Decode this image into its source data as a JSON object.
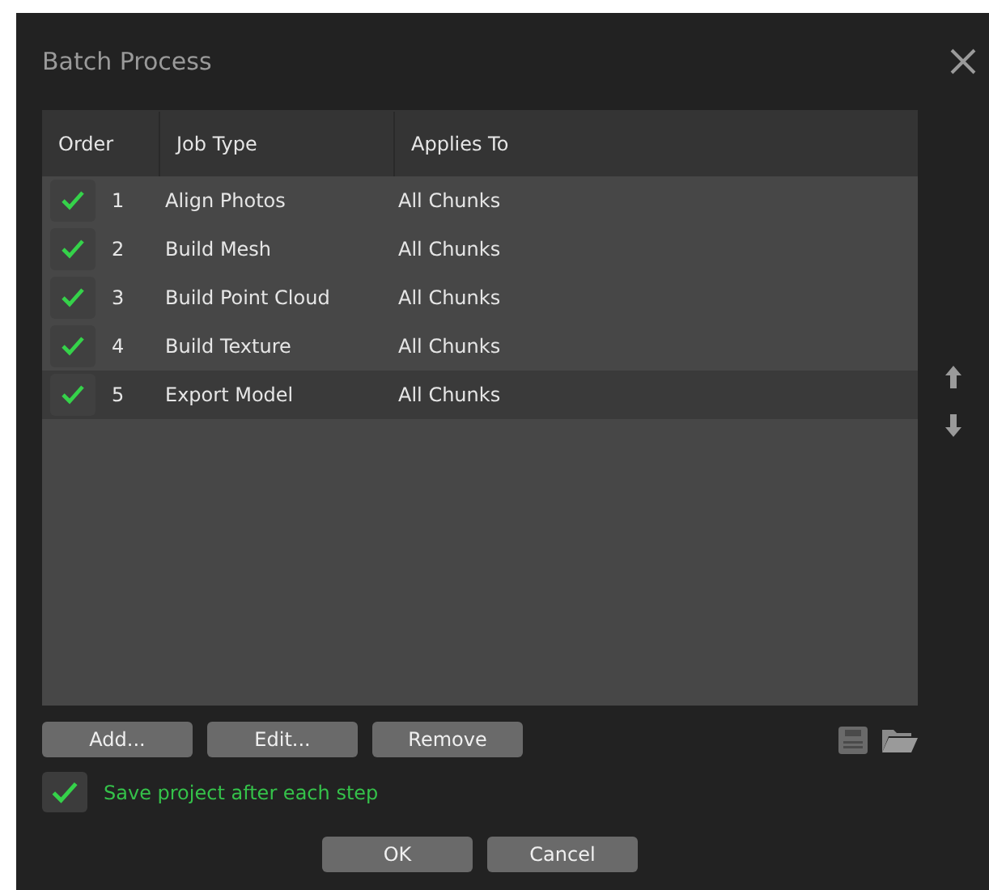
{
  "window": {
    "title": "Batch Process"
  },
  "table": {
    "columns": [
      "Order",
      "Job Type",
      "Applies To"
    ],
    "rows": [
      {
        "checked": true,
        "order": "1",
        "job_type": "Align Photos",
        "applies_to": "All Chunks",
        "selected": false
      },
      {
        "checked": true,
        "order": "2",
        "job_type": "Build Mesh",
        "applies_to": "All Chunks",
        "selected": false
      },
      {
        "checked": true,
        "order": "3",
        "job_type": "Build Point Cloud",
        "applies_to": "All Chunks",
        "selected": false
      },
      {
        "checked": true,
        "order": "4",
        "job_type": "Build Texture",
        "applies_to": "All Chunks",
        "selected": false
      },
      {
        "checked": true,
        "order": "5",
        "job_type": "Export Model",
        "applies_to": "All Chunks",
        "selected": true
      }
    ]
  },
  "list_buttons": [
    "Add...",
    "Edit...",
    "Remove"
  ],
  "save_option": {
    "label": "Save project after each step",
    "checked": true
  },
  "buttons": [
    "OK",
    "Cancel"
  ]
}
